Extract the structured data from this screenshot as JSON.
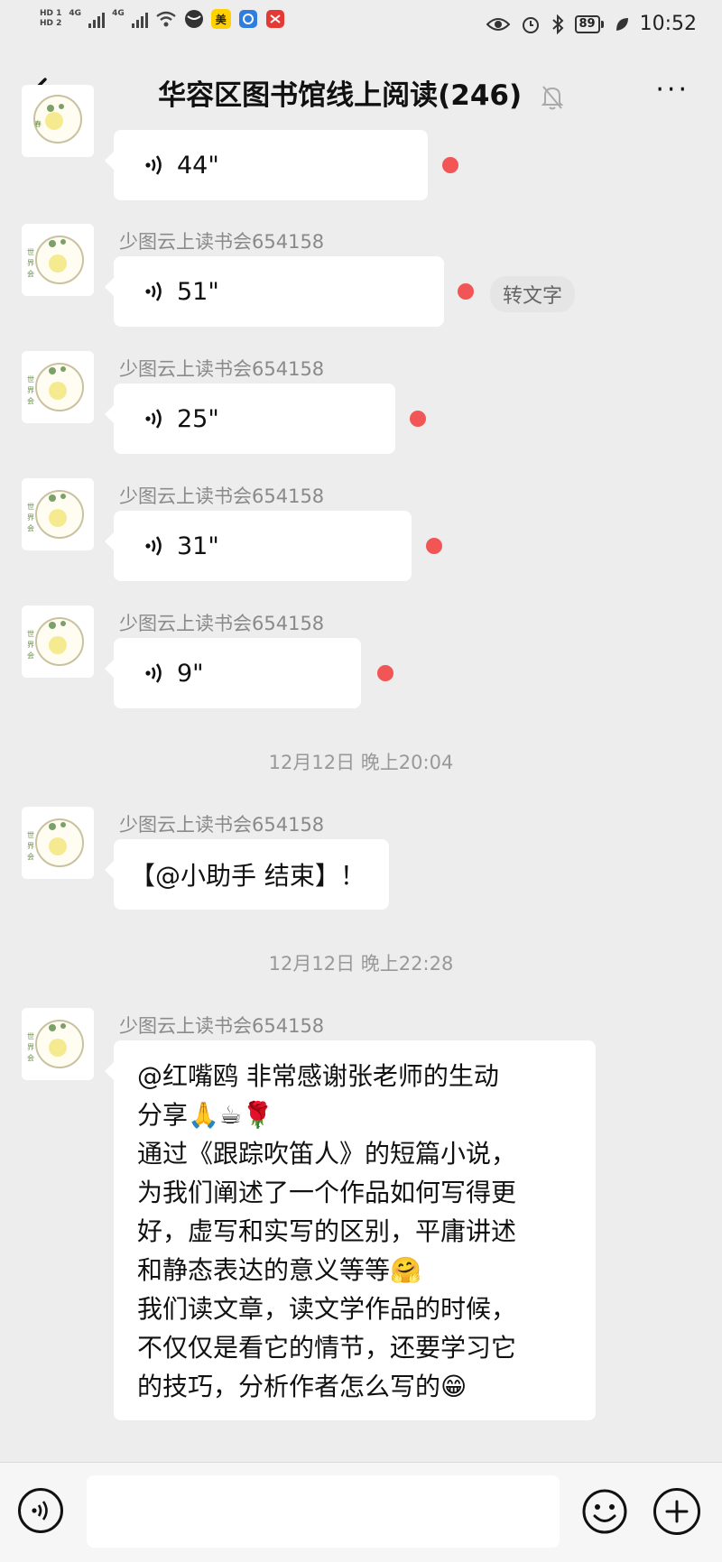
{
  "status_bar": {
    "hd1": "HD",
    "hd2": "HD",
    "sim1": "1",
    "sim2": "2",
    "net1": "4G",
    "net2": "4G",
    "app_mei": "美",
    "battery": "89",
    "time": "10:52"
  },
  "header": {
    "title": "华容区图书馆线上阅读(246)"
  },
  "messages": [
    {
      "sender": "",
      "duration": "44\""
    },
    {
      "sender": "少图云上读书会654158",
      "duration": "51\"",
      "convert_label": "转文字"
    },
    {
      "sender": "少图云上读书会654158",
      "duration": "25\""
    },
    {
      "sender": "少图云上读书会654158",
      "duration": "31\""
    },
    {
      "sender": "少图云上读书会654158",
      "duration": "9\""
    }
  ],
  "timestamp1": "12月12日 晚上20:04",
  "msg6": {
    "sender": "少图云上读书会654158",
    "text": "【@小助手 结束】！"
  },
  "timestamp2": "12月12日 晚上22:28",
  "msg7": {
    "sender": "少图云上读书会654158",
    "line1": "@红嘴鸥  非常感谢张老师的生动",
    "line2": "分享",
    "emojis_line2": "🙏☕🌹",
    "line3": "通过《跟踪吹笛人》的短篇小说，",
    "line4": "为我们阐述了一个作品如何写得更",
    "line5": "好，虚写和实写的区别，平庸讲述",
    "line6": "和静态表达的意义等等",
    "emoji_line6": "🤗",
    "line7": "我们读文章，读文学作品的时候，",
    "line8": "不仅仅是看它的情节，还要学习它",
    "line9": "的技巧，分析作者怎么写的",
    "emoji_line9": "😁"
  },
  "colors": {
    "background": "#ededed",
    "bubble": "#ffffff",
    "unread_dot": "#f25555",
    "meta_text": "#8a8a8a"
  },
  "icons": [
    "back-icon",
    "mute-bell-icon",
    "more-icon",
    "voice-wave-icon",
    "voice-input-icon",
    "emoji-icon",
    "plus-icon"
  ]
}
